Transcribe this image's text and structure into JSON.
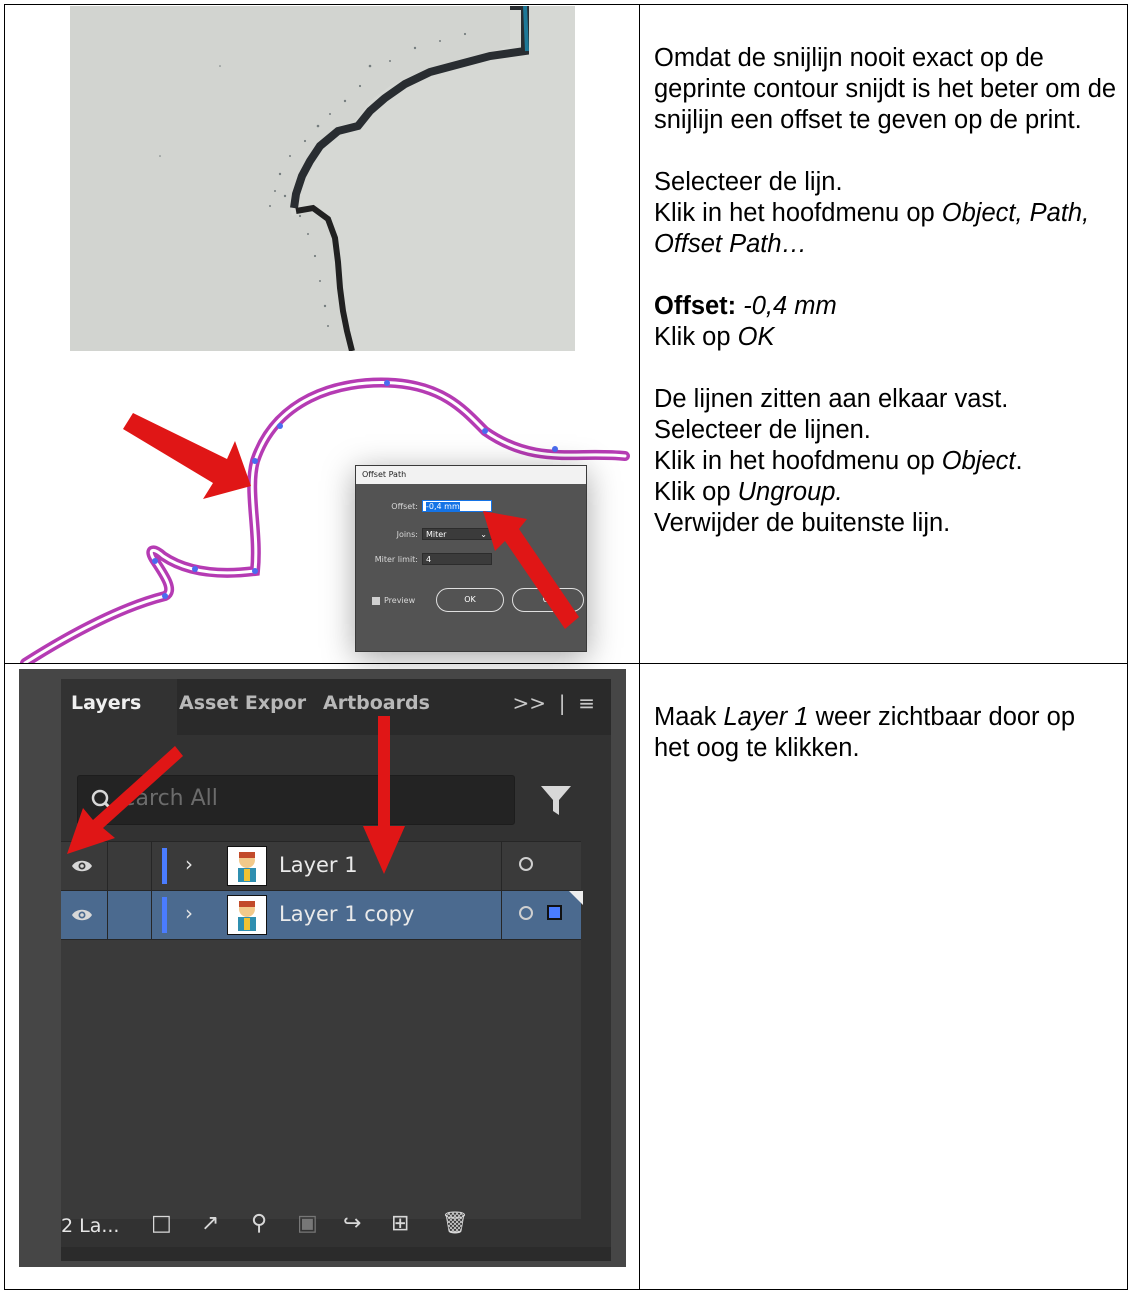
{
  "row1": {
    "paragraphs": {
      "p1": "Omdat de snijlijn nooit exact op de geprinte contour snijdt is het beter om de snijlijn een offset te geven op de print.",
      "p2": "Selecteer de lijn.",
      "p3_prefix": "Klik in het hoofdmenu op ",
      "p3_italic": "Object, Path, Offset Path…",
      "p4_bold": "Offset:",
      "p4_italic": " -0,4 mm",
      "p5_prefix": "Klik op ",
      "p5_italic": "OK",
      "p6": "De lijnen zitten aan elkaar vast.",
      "p7": "Selecteer de lijnen.",
      "p8_prefix": "Klik in het hoofdmenu op ",
      "p8_italic": "Object",
      "p8_suffix": ".",
      "p9_prefix": "Klik op ",
      "p9_italic": "Ungroup.",
      "p10": "Verwijder de buitenste lijn."
    },
    "dialog": {
      "title": "Offset Path",
      "offset_label": "Offset:",
      "offset_value": "-0,4 mm",
      "joins_label": "Joins:",
      "joins_value": "Miter",
      "miter_label": "Miter limit:",
      "miter_value": "4",
      "preview_label": "Preview",
      "ok_label": "OK",
      "cancel_label": "Ca"
    }
  },
  "row2": {
    "text_prefix": "Maak ",
    "text_italic": "Layer 1",
    "text_suffix": " weer zichtbaar door op het oog te klikken.",
    "panel": {
      "tabs": [
        "Layers",
        "Asset Expor",
        "Artboards"
      ],
      "tab_overflow": ">>",
      "search_placeholder": "earch All",
      "layers": [
        {
          "name": "Layer 1"
        },
        {
          "name": "Layer 1 copy"
        }
      ],
      "footer_count": "2 La..."
    }
  }
}
